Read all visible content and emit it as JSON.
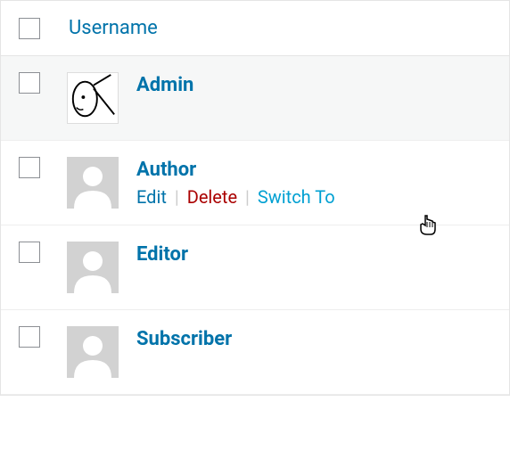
{
  "header": {
    "username_col": "Username"
  },
  "rows": [
    {
      "username": "Admin",
      "avatar": "custom",
      "highlighted": true,
      "actions_visible": false
    },
    {
      "username": "Author",
      "avatar": "default",
      "highlighted": false,
      "actions_visible": true
    },
    {
      "username": "Editor",
      "avatar": "default",
      "highlighted": false,
      "actions_visible": false
    },
    {
      "username": "Subscriber",
      "avatar": "default",
      "highlighted": false,
      "actions_visible": false
    }
  ],
  "actions": {
    "edit": "Edit",
    "delete": "Delete",
    "switch": "Switch To"
  }
}
